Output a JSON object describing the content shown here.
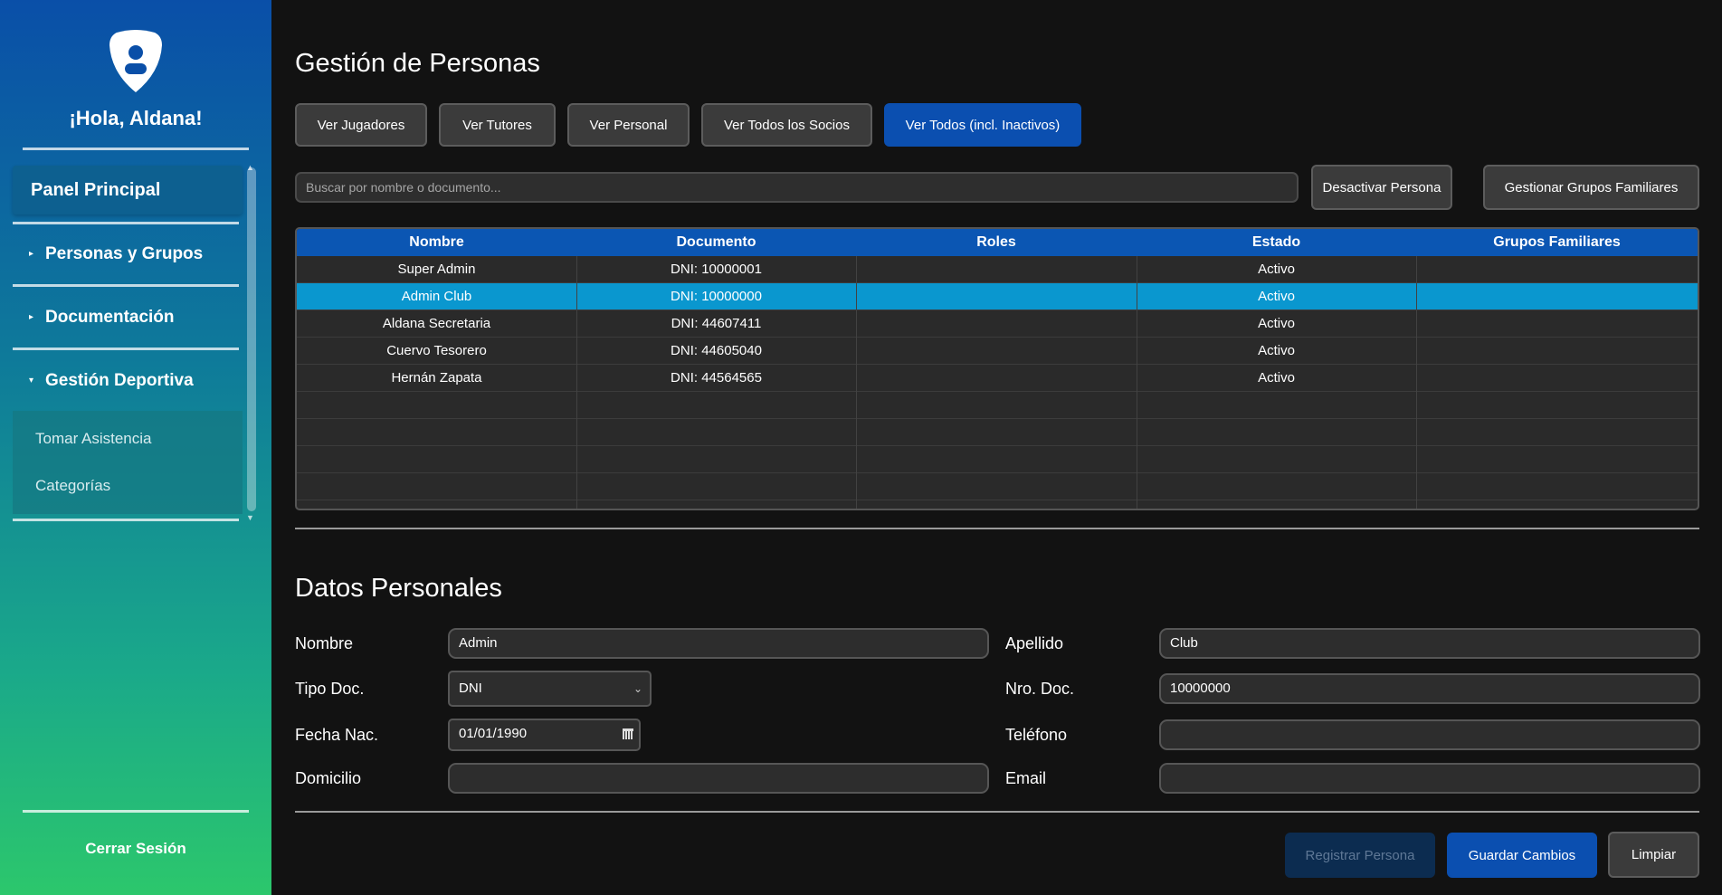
{
  "sidebar": {
    "greeting": "¡Hola, Aldana!",
    "panel_principal": "Panel Principal",
    "items": [
      {
        "label": "Personas y Grupos",
        "expanded": false
      },
      {
        "label": "Documentación",
        "expanded": false
      },
      {
        "label": "Gestión Deportiva",
        "expanded": true
      }
    ],
    "subitems": [
      "Tomar Asistencia",
      "Categorías"
    ],
    "logout": "Cerrar Sesión"
  },
  "main": {
    "title": "Gestión de Personas",
    "filters": [
      {
        "label": "Ver Jugadores",
        "active": false
      },
      {
        "label": "Ver Tutores",
        "active": false
      },
      {
        "label": "Ver Personal",
        "active": false
      },
      {
        "label": "Ver Todos los Socios",
        "active": false
      },
      {
        "label": "Ver Todos (incl. Inactivos)",
        "active": true
      }
    ],
    "search_placeholder": "Buscar por nombre o documento...",
    "deactivate_button": "Desactivar Persona",
    "family_groups_button": "Gestionar Grupos Familiares",
    "table": {
      "columns": [
        "Nombre",
        "Documento",
        "Roles",
        "Estado",
        "Grupos Familiares"
      ],
      "rows": [
        {
          "nombre": "Super Admin",
          "documento": "DNI: 10000001",
          "roles": "",
          "estado": "Activo",
          "grupos": "",
          "selected": false
        },
        {
          "nombre": "Admin Club",
          "documento": "DNI: 10000000",
          "roles": "",
          "estado": "Activo",
          "grupos": "",
          "selected": true
        },
        {
          "nombre": "Aldana Secretaria",
          "documento": "DNI: 44607411",
          "roles": "",
          "estado": "Activo",
          "grupos": "",
          "selected": false
        },
        {
          "nombre": "Cuervo Tesorero",
          "documento": "DNI: 44605040",
          "roles": "",
          "estado": "Activo",
          "grupos": "",
          "selected": false
        },
        {
          "nombre": "Hernán Zapata",
          "documento": "DNI: 44564565",
          "roles": "",
          "estado": "Activo",
          "grupos": "",
          "selected": false
        }
      ]
    }
  },
  "form": {
    "title": "Datos Personales",
    "nombre_label": "Nombre",
    "nombre_value": "Admin",
    "apellido_label": "Apellido",
    "apellido_value": "Club",
    "tipo_doc_label": "Tipo Doc.",
    "tipo_doc_value": "DNI",
    "nro_doc_label": "Nro. Doc.",
    "nro_doc_value": "10000000",
    "fecha_nac_label": "Fecha Nac.",
    "fecha_nac_value": "01/01/1990",
    "telefono_label": "Teléfono",
    "telefono_value": "",
    "domicilio_label": "Domicilio",
    "domicilio_value": "",
    "email_label": "Email",
    "email_value": ""
  },
  "actions": {
    "register": "Registrar Persona",
    "save": "Guardar Cambios",
    "clear": "Limpiar"
  },
  "colors": {
    "accent": "#0b4fb0",
    "selected_row": "#0a97cf",
    "background": "#121212"
  }
}
